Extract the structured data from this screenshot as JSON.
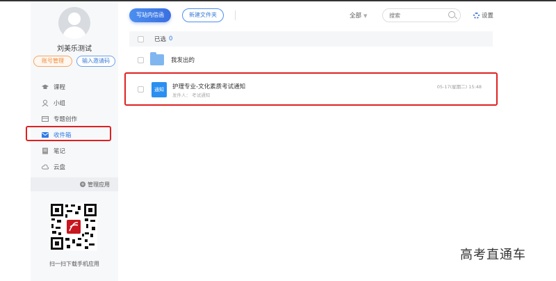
{
  "sidebar": {
    "username": "刘美乐测试",
    "account_btn": "账号管理",
    "invite_btn": "输入邀请码",
    "items": [
      {
        "label": "课程",
        "icon": "graduation-cap-icon"
      },
      {
        "label": "小组",
        "icon": "group-icon"
      },
      {
        "label": "专题创作",
        "icon": "topic-icon"
      },
      {
        "label": "收件箱",
        "icon": "inbox-icon",
        "active": true
      },
      {
        "label": "笔记",
        "icon": "note-icon"
      },
      {
        "label": "云盘",
        "icon": "cloud-icon"
      }
    ],
    "manage_apps": "管理应用",
    "qr_caption": "扫一扫下载手机应用"
  },
  "toolbar": {
    "write_btn": "写站内信函",
    "new_folder_btn": "新建文件夹",
    "filter_label": "全部",
    "search_placeholder": "搜索",
    "settings_label": "设置"
  },
  "list": {
    "selected_label": "已选",
    "selected_count": "0",
    "folder_label": "我发出的",
    "message": {
      "badge": "通知",
      "title": "护理专业-文化素质考试通知",
      "meta": "发件人：  考试通知",
      "time": "05-17(星期二) 15:48"
    }
  },
  "watermark": "高考直通车",
  "colors": {
    "accent": "#2f7be6",
    "highlight": "#e02020"
  }
}
